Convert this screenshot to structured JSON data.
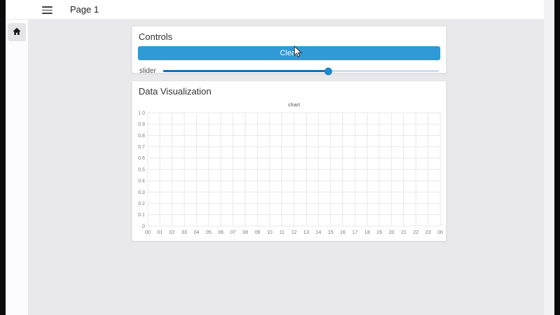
{
  "topbar": {
    "title": "Page 1",
    "menu_icon": "hamburger-icon"
  },
  "sidebar": {
    "home_button": {
      "icon": "home-icon"
    }
  },
  "controls": {
    "title": "Controls",
    "clear_button": {
      "label": "Clear",
      "bg_color": "#2f9ad5",
      "text_color": "#ffffff"
    },
    "slider": {
      "label": "slider",
      "value_fraction": 0.6,
      "fill_color": "#1a6cb0",
      "track_color": "#c9e0f0",
      "thumb_color": "#1e88c9"
    }
  },
  "visualization": {
    "title": "Data Visualization"
  },
  "chart_data": {
    "type": "line",
    "title": "chart",
    "x_tick_labels": [
      "00",
      "01",
      "02",
      "03",
      "04",
      "05",
      "06",
      "07",
      "08",
      "09",
      "10",
      "11",
      "12",
      "13",
      "14",
      "15",
      "16",
      "17",
      "18",
      "19",
      "20",
      "21",
      "22",
      "23",
      "00"
    ],
    "y_tick_labels": [
      "1.0",
      "0.9",
      "0.8",
      "0.7",
      "0.6",
      "0.5",
      "0.4",
      "0.3",
      "0.2",
      "0.1",
      "0"
    ],
    "ylim": [
      0,
      1
    ],
    "series": [],
    "grid": true,
    "legend": false,
    "grid_color": "#e9e9ea",
    "tick_color": "#7a7a7a",
    "title_color": "#555555"
  }
}
